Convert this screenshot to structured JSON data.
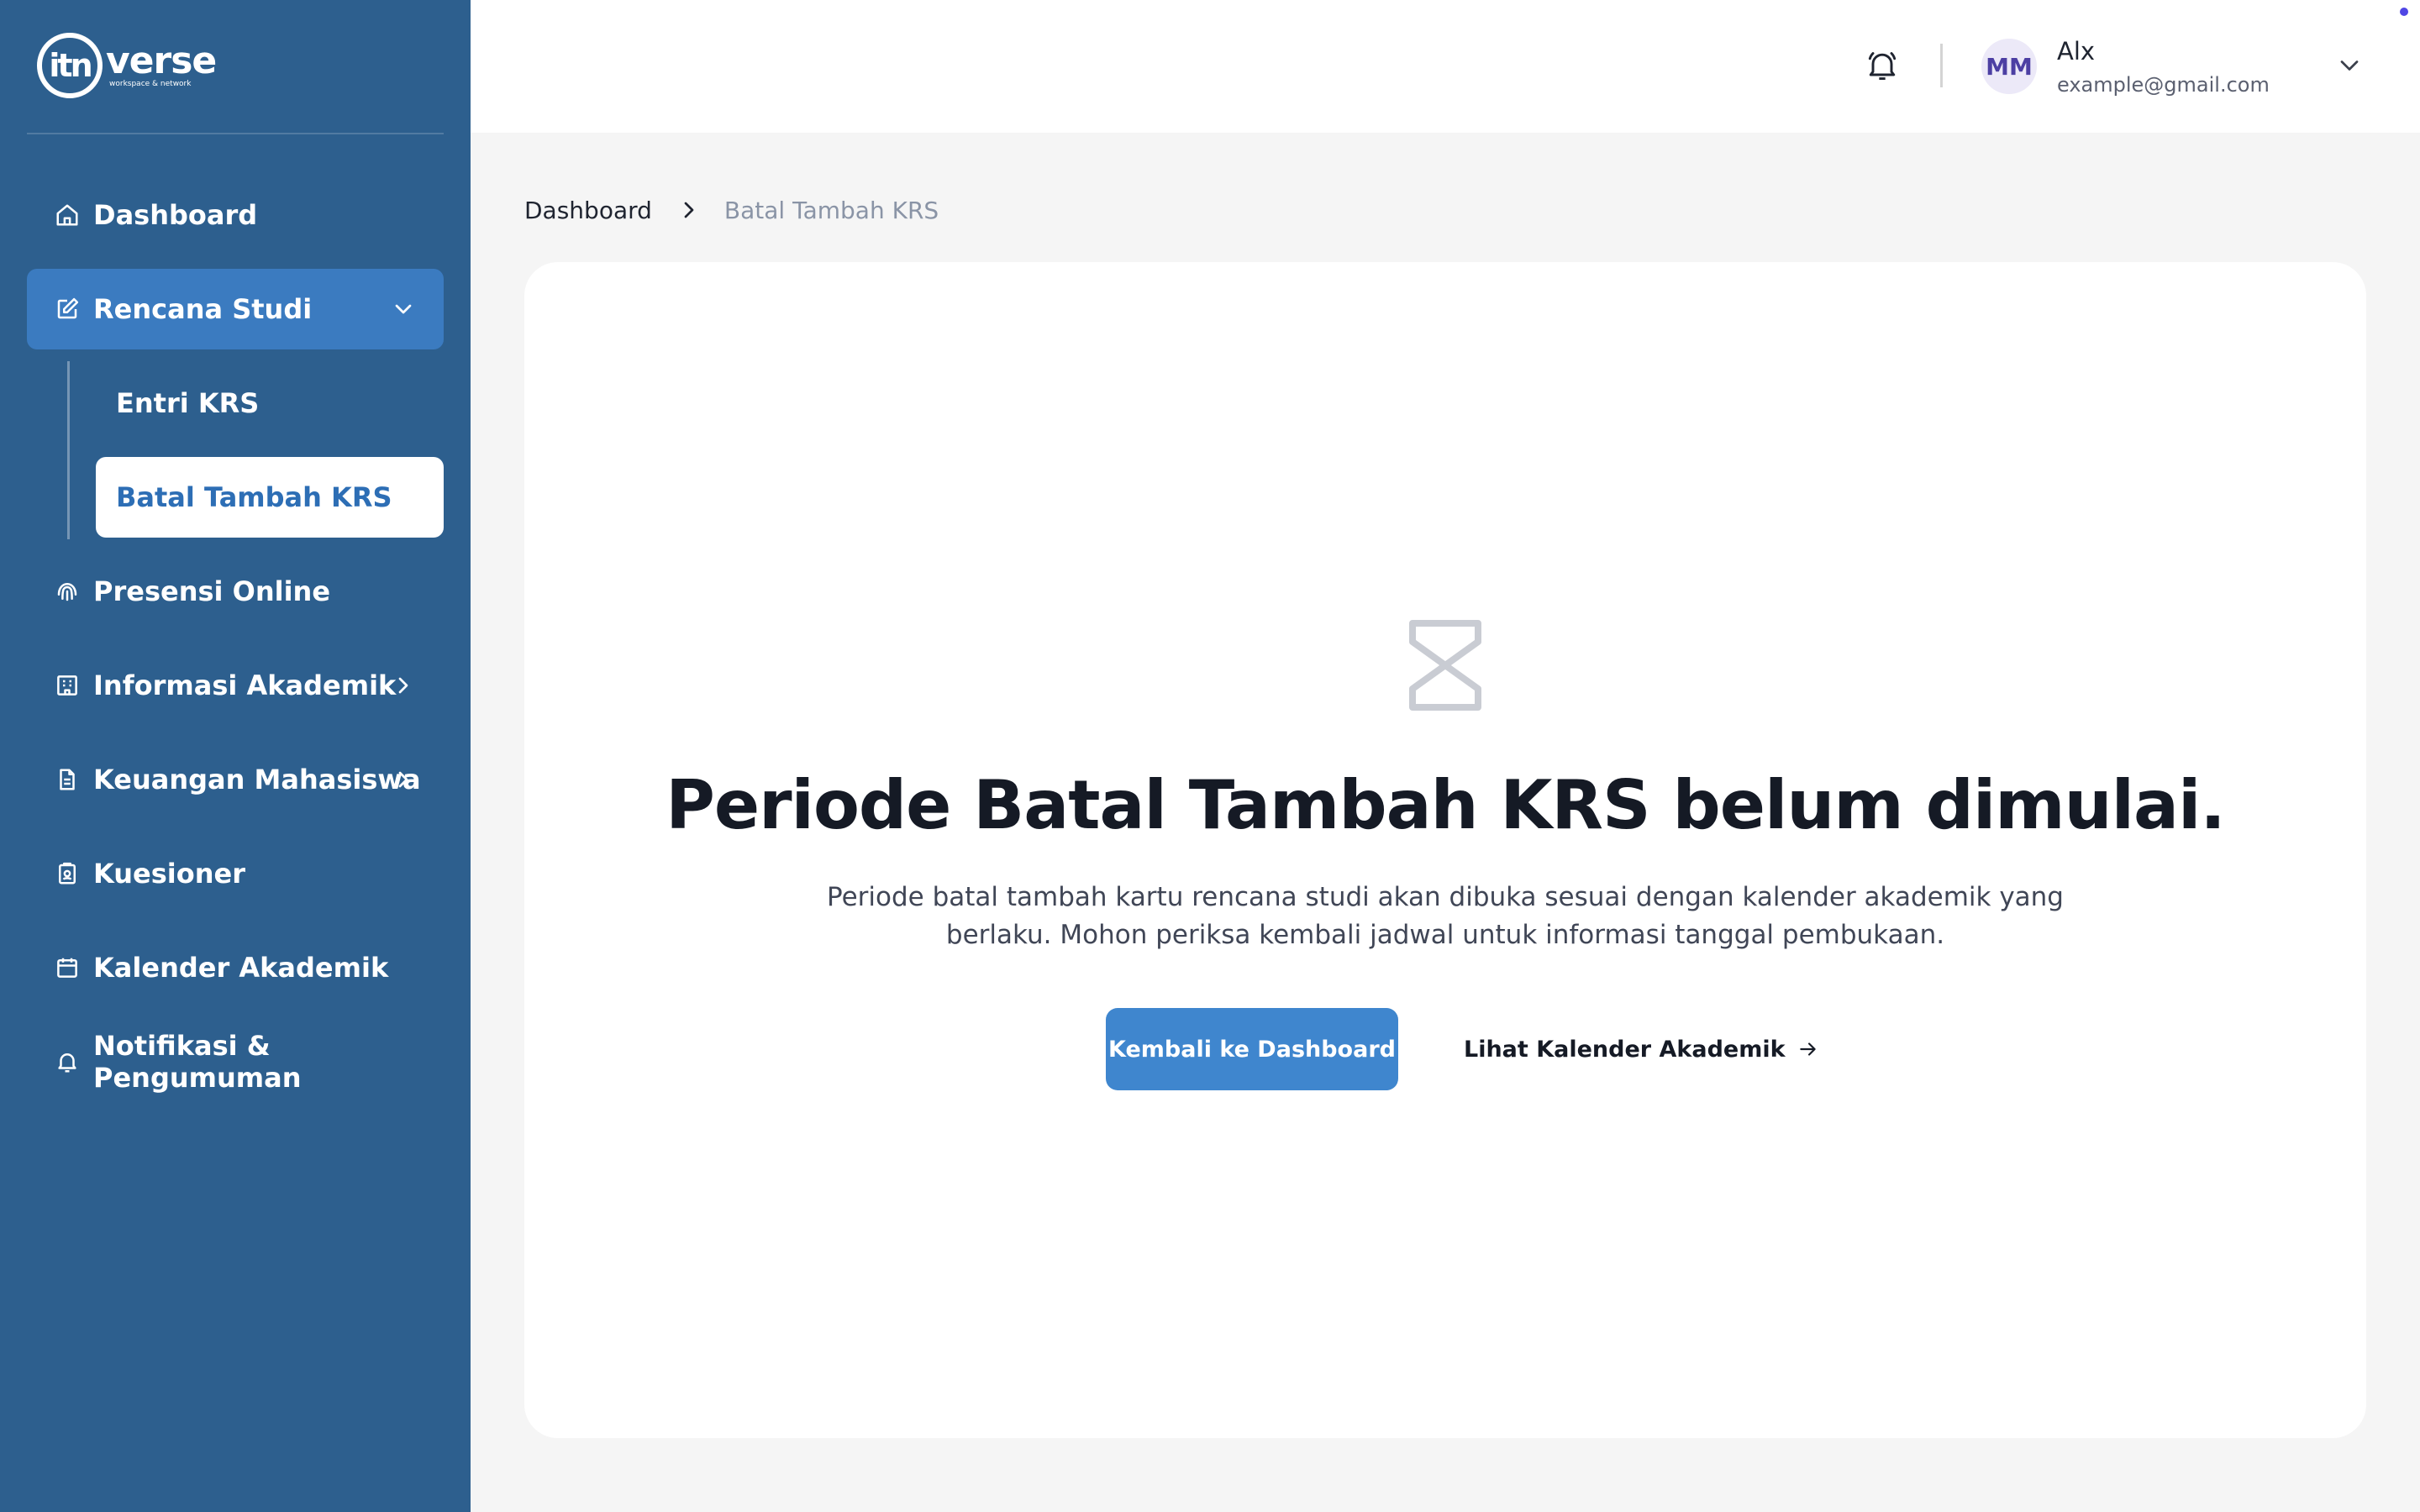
{
  "brand": {
    "mark": "itn",
    "name": "verse",
    "tagline": "workspace & network"
  },
  "sidebar": {
    "items": [
      {
        "label": "Dashboard",
        "icon": "home-icon"
      },
      {
        "label": "Rencana Studi",
        "icon": "edit-icon",
        "expanded": true,
        "children": [
          {
            "label": "Entri KRS"
          },
          {
            "label": "Batal Tambah KRS",
            "active": true
          }
        ]
      },
      {
        "label": "Presensi Online",
        "icon": "fingerprint-icon"
      },
      {
        "label": "Informasi Akademik",
        "icon": "building-icon"
      },
      {
        "label": "Keuangan Mahasiswa",
        "icon": "document-icon"
      },
      {
        "label": "Kuesioner",
        "icon": "clipboard-icon"
      },
      {
        "label": "Kalender Akademik",
        "icon": "calendar-icon"
      },
      {
        "label": "Notifikasi & Pengumuman",
        "icon": "bell-icon"
      }
    ]
  },
  "header": {
    "user": {
      "initials": "MM",
      "name": "Alx",
      "email": "example@gmail.com"
    }
  },
  "breadcrumb": {
    "home": "Dashboard",
    "current": "Batal Tambah KRS"
  },
  "main": {
    "title": "Periode Batal Tambah KRS belum dimulai.",
    "description": "Periode batal tambah kartu rencana studi akan dibuka sesuai dengan kalender akademik yang berlaku. Mohon periksa kembali jadwal untuk informasi tanggal pembukaan.",
    "primary_button": "Kembali ke Dashboard",
    "secondary_link": "Lihat Kalender Akademik"
  },
  "colors": {
    "sidebar": "#2d5f8e",
    "active_group": "#3b7bc0",
    "primary": "#3f86ce",
    "page_bg": "#f5f5f5"
  }
}
